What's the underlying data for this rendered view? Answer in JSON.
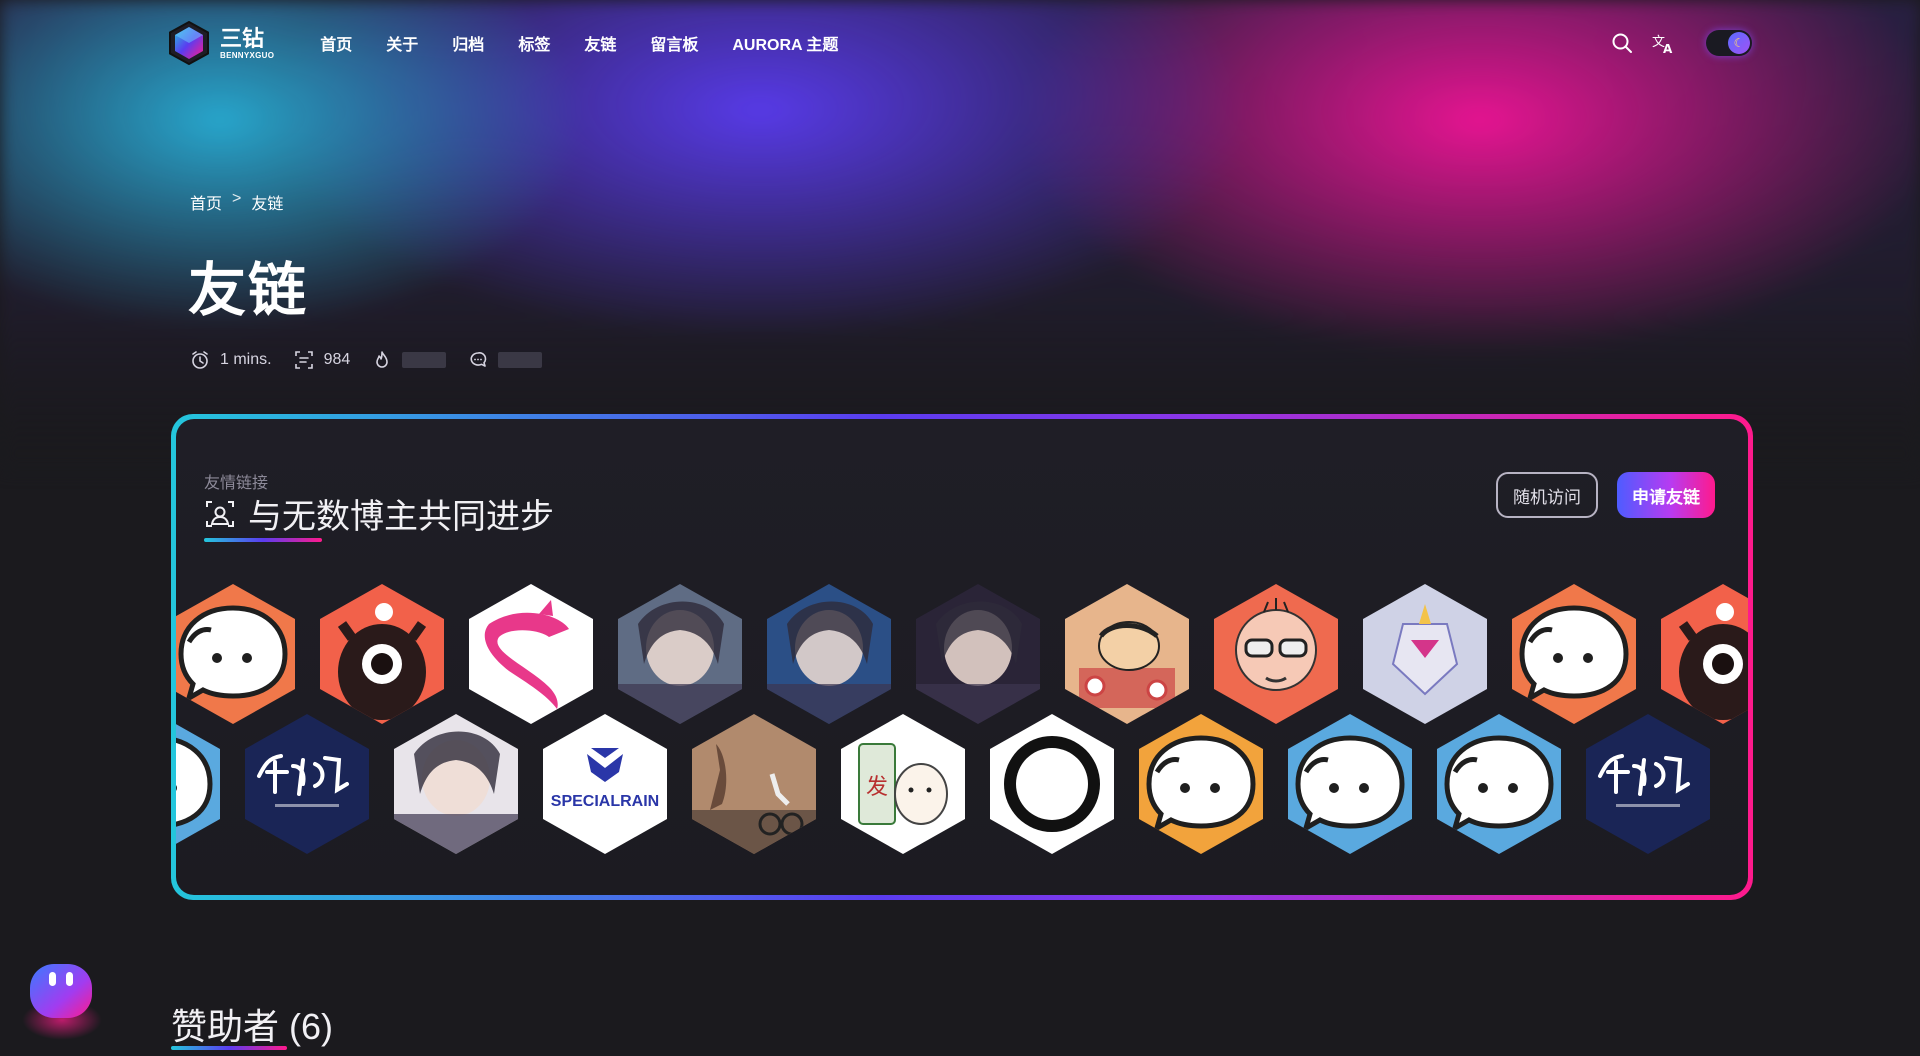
{
  "site": {
    "title": "三钻",
    "subtitle": "BENNYXGUO"
  },
  "nav": [
    "首页",
    "关于",
    "归档",
    "标签",
    "友链",
    "留言板",
    "AURORA 主题"
  ],
  "header_icons": [
    "search-icon",
    "translate-icon",
    "theme-toggle"
  ],
  "breadcrumb": {
    "home": "首页",
    "sep": ">",
    "current": "友链"
  },
  "page": {
    "title": "友链",
    "meta": {
      "read_time": "1 mins.",
      "word_count": "984"
    }
  },
  "friends": {
    "subtitle": "友情链接",
    "title": "与无数博主共同进步",
    "random_button": "随机访问",
    "apply_button": "申请友链",
    "row1": [
      {
        "kind": "mascot",
        "bg": "#f0784a"
      },
      {
        "kind": "eye",
        "bg": "#f2614a"
      },
      {
        "kind": "dragon",
        "bg": "#ffffff"
      },
      {
        "kind": "anime",
        "bg": "#5f6c84"
      },
      {
        "kind": "anime",
        "bg": "#2b4f86"
      },
      {
        "kind": "anime",
        "bg": "#2a2437"
      },
      {
        "kind": "cartoon",
        "bg": "#e7b58c"
      },
      {
        "kind": "face",
        "bg": "#ef6a4f"
      },
      {
        "kind": "robot",
        "bg": "#cfd2e6"
      },
      {
        "kind": "mascot",
        "bg": "#f0784a"
      },
      {
        "kind": "eye",
        "bg": "#f2614a"
      }
    ],
    "row2": [
      {
        "kind": "mascot",
        "bg": "#5aa9df"
      },
      {
        "kind": "calligraphy",
        "bg": "#1a2556"
      },
      {
        "kind": "anime",
        "bg": "#e8e4ea"
      },
      {
        "kind": "logo",
        "bg": "#ffffff",
        "text": "SPECIALRAIN"
      },
      {
        "kind": "photo",
        "bg": "#b18a6d"
      },
      {
        "kind": "bear",
        "bg": "#ffffff"
      },
      {
        "kind": "ring",
        "bg": "#ffffff"
      },
      {
        "kind": "mascot",
        "bg": "#f2a33c"
      },
      {
        "kind": "mascot",
        "bg": "#5aa9df"
      },
      {
        "kind": "mascot",
        "bg": "#5aa9df"
      },
      {
        "kind": "calligraphy",
        "bg": "#1a2556"
      }
    ]
  },
  "sponsors": {
    "title": "赞助者 (6)"
  },
  "colors": {
    "accent_cyan": "#24c6dc",
    "accent_purple": "#5b3cf0",
    "accent_pink": "#ff1a8c",
    "background": "#1b1a1e"
  }
}
